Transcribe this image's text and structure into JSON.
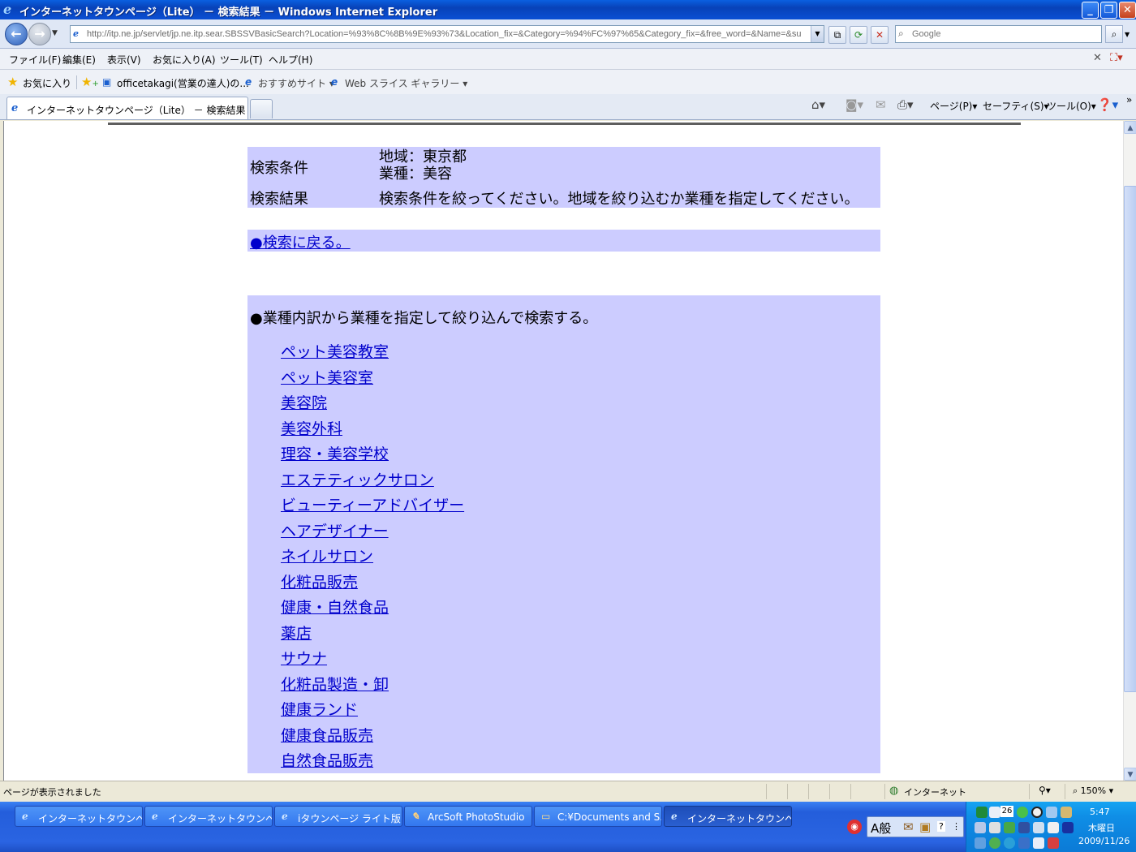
{
  "window": {
    "title": "インターネットタウンページ（Lite） － 検索結果 － Windows Internet Explorer",
    "minimize": "_",
    "maximize": "❐",
    "close": "✕"
  },
  "address": {
    "url": "http://itp.ne.jp/servlet/jp.ne.itp.sear.SBSSVBasicSearch?Location=%93%8C%8B%9E%93%73&Location_fix=&Category=%94%FC%97%65&Category_fix=&free_word=&Name=&submitT:",
    "search_placeholder": "Google"
  },
  "menu": [
    "ファイル(F)",
    "編集(E)",
    "表示(V)",
    "お気に入り(A)",
    "ツール(T)",
    "ヘルプ(H)"
  ],
  "favorites": {
    "label": "お気に入り",
    "items": [
      "officetakagi(営業の達人)の...",
      "おすすめサイト ▾",
      "Web スライス ギャラリー ▾"
    ]
  },
  "tab": {
    "label": "インターネットタウンページ（Lite） － 検索結果"
  },
  "commands": {
    "page": "ページ(P)▾",
    "safety": "セーフティ(S)▾",
    "tools": "ツール(O)▾"
  },
  "content": {
    "conditions_label": "検索条件",
    "condition_area": "地域：東京都",
    "condition_category": "業種：美容",
    "result_label": "検索結果",
    "result_text": "検索条件を絞ってください。地域を絞り込むか業種を指定してください。",
    "back_link": "●検索に戻る。",
    "narrow_heading": "●業種内訳から業種を指定して絞り込んで検索する。",
    "categories": [
      "ペット美容教室",
      "ペット美容室",
      "美容院",
      "美容外科",
      "理容・美容学校",
      "エステティックサロン",
      "ビューティーアドバイザー",
      "ヘアデザイナー",
      "ネイルサロン",
      "化粧品販売",
      "健康・自然食品",
      "薬店",
      "サウナ",
      "化粧品製造・卸",
      "健康ランド",
      "健康食品販売",
      "自然食品販売"
    ]
  },
  "status": {
    "text": "ページが表示されました",
    "zone": "インターネット",
    "zoom": "150%"
  },
  "taskbar": {
    "tasks": [
      "インターネットタウンペー...",
      "インターネットタウンペー...",
      "iタウンページ ライト版 -...",
      "ArcSoft PhotoStudio",
      "C:¥Documents and S...",
      "インターネットタウンペー..."
    ],
    "ime": "A般",
    "cal_day": "26",
    "time": "5:47",
    "weekday": "木曜日",
    "date": "2009/11/26"
  }
}
